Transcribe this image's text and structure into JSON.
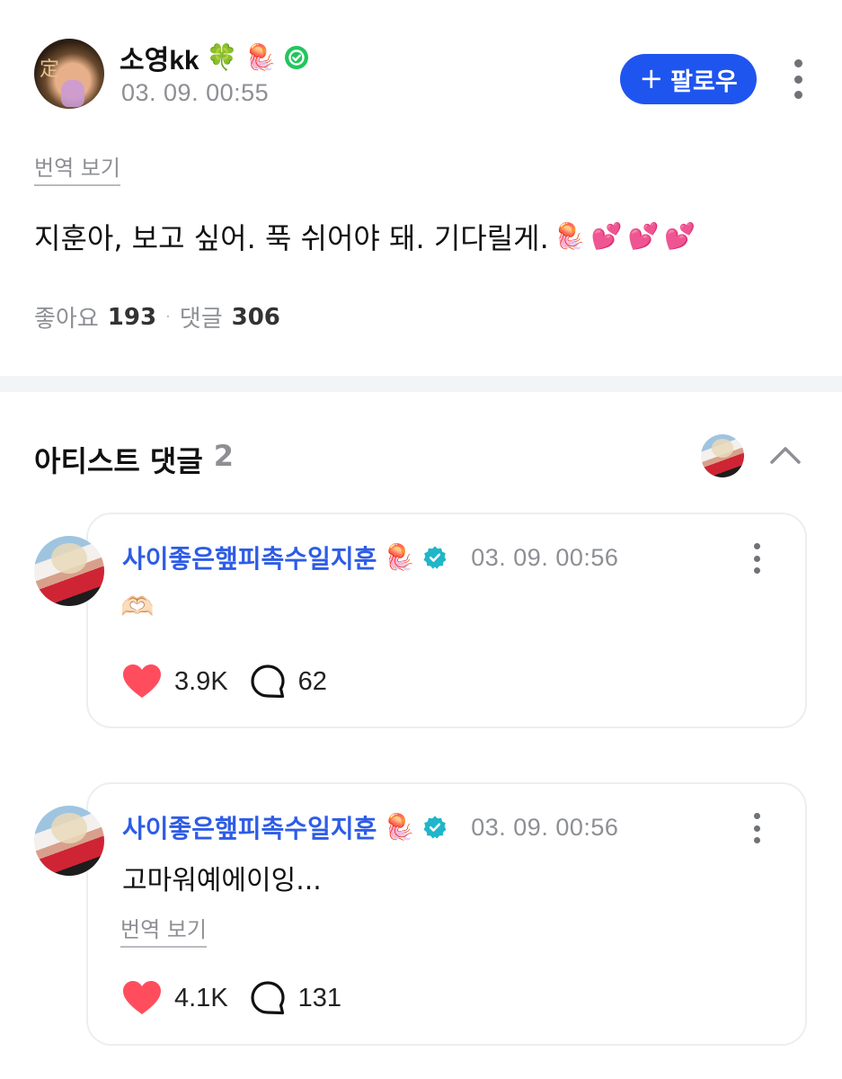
{
  "post": {
    "username": "소영kk",
    "name_emojis": [
      "🍀",
      "🪼"
    ],
    "verified_color": "#22c55e",
    "timestamp": "03. 09. 00:55",
    "follow_button": {
      "icon": "+",
      "label": "팔로우",
      "color": "#1f55ef"
    },
    "translate_label": "번역 보기",
    "body_text": "지훈아, 보고 싶어. 푹 쉬어야 돼. 기다릴게.",
    "body_emojis": [
      "🪼",
      "💕",
      "💕",
      "💕"
    ],
    "likes_label": "좋아요",
    "likes_count": "193",
    "separator": "·",
    "comments_label": "댓글",
    "comments_count": "306"
  },
  "artist_section": {
    "title": "아티스트 댓글",
    "count": "2",
    "collapse_icon": "chevron-up-icon"
  },
  "comments": [
    {
      "author": "사이좋은햎피촉수일지훈",
      "author_emoji": "🪼",
      "badge_color": "#1fb6c9",
      "timestamp": "03. 09. 00:56",
      "text": "🫶🏻",
      "likes": "3.9K",
      "replies": "62"
    },
    {
      "author": "사이좋은햎피촉수일지훈",
      "author_emoji": "🪼",
      "badge_color": "#1fb6c9",
      "timestamp": "03. 09. 00:56",
      "text": "고마워예에이잉...",
      "translate_label": "번역 보기",
      "likes": "4.1K",
      "replies": "131"
    }
  ],
  "colors": {
    "accent": "#1f55ef",
    "name_link": "#2e5ce6",
    "heart": "#ff4d5e",
    "muted": "#8d8f94"
  }
}
